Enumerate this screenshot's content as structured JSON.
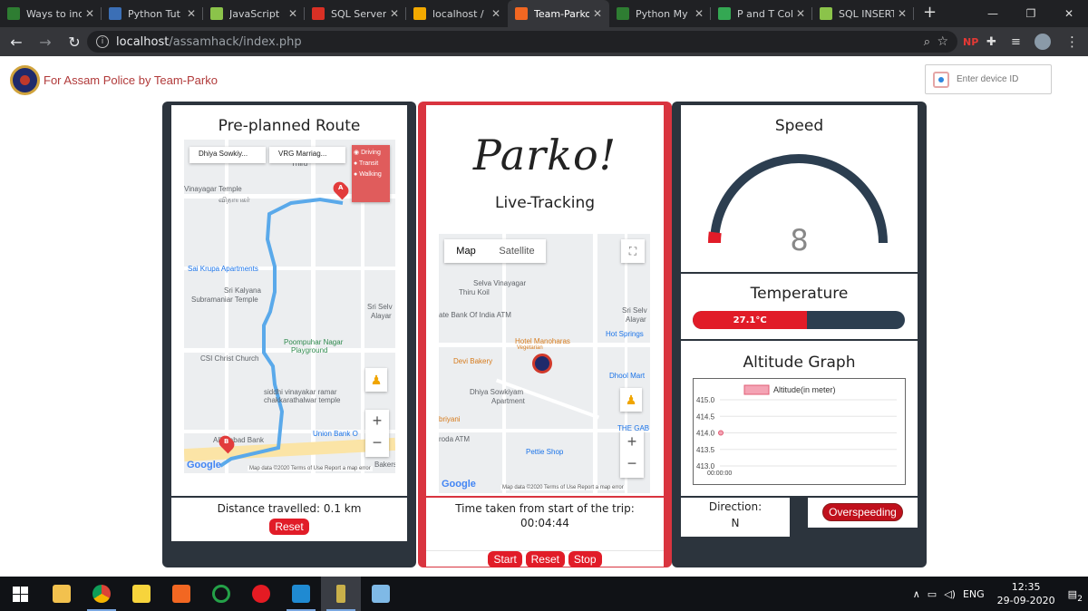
{
  "browser": {
    "tabs": [
      {
        "title": "Ways to inc",
        "color": "#2e7d32"
      },
      {
        "title": "Python Tut",
        "color": "#3b6fb6"
      },
      {
        "title": "JavaScript",
        "color": "#8bc34a"
      },
      {
        "title": "SQL Server",
        "color": "#d93025"
      },
      {
        "title": "localhost /",
        "color": "#f2a900"
      },
      {
        "title": "Team-Parko",
        "color": "#f26722"
      },
      {
        "title": "Python My",
        "color": "#2e7d32"
      },
      {
        "title": "P and T Col",
        "color": "#34a853"
      },
      {
        "title": "SQL INSERT",
        "color": "#8bc34a"
      }
    ],
    "active_tab": 5,
    "url_host": "localhost",
    "url_path": "/assamhack/index.php",
    "new_tab": "+",
    "ext_np": "NP"
  },
  "header": {
    "brand": "For Assam Police by Team-Parko",
    "device_placeholder": "Enter device ID"
  },
  "route": {
    "title": "Pre-planned Route",
    "from": "Dhiya Sowkiy...",
    "to": "VRG Marriag...",
    "modes": [
      "Driving",
      "Transit",
      "Walking"
    ],
    "places": [
      "Vinayagar Temple",
      "விநாயகர்",
      "Sai Krupa Apartments",
      "Sri Kalyana",
      "Subramaniar Temple",
      "Sri Selv",
      "Alayar",
      "Poompuhar Nagar",
      "Playground",
      "CSI Christ Church",
      "siddhi vinayakar ramar",
      "chakkarathalwar temple",
      "Union Bank O",
      "Allahabad Bank",
      "Bakers",
      "Thiru"
    ],
    "marker_a": "A",
    "marker_b": "B",
    "zoom_in": "+",
    "zoom_out": "−",
    "attribution": [
      "Map data ©2020",
      "Terms of Use",
      "Report a map error"
    ],
    "google": "Google",
    "distance": "Distance travelled: 0.1 km",
    "reset": "Reset"
  },
  "live": {
    "logo": "Parko!",
    "title": "Live-Tracking",
    "map_type": "Map",
    "satellite": "Satellite",
    "places": [
      "Selva Vinayagar",
      "Thiru Koil",
      "ate Bank Of India ATM",
      "Hotel Manoharas",
      "Vegetarian",
      "Hot Springs",
      "Devi Bakery",
      "Dhool Mart",
      "Dhiya Sowkiyam",
      "Apartment",
      "briyani",
      "THE GAB",
      "roda ATM",
      "Pettie Shop",
      "Sri Selv",
      "Alayar"
    ],
    "zoom_in": "+",
    "zoom_out": "−",
    "attribution": [
      "Map data ©2020",
      "Terms of Use",
      "Report a map error"
    ],
    "google": "Google",
    "time_label": "Time taken from start of the trip:",
    "time_value": "00:04:44",
    "buttons": [
      "Start",
      "Reset",
      "Stop"
    ]
  },
  "speed": {
    "title": "Speed",
    "value": "8",
    "fraction": 0.04
  },
  "temperature": {
    "title": "Temperature",
    "value": "27.1°C",
    "fraction": 0.54,
    "color": "#e11c28"
  },
  "altitude": {
    "title": "Altitude Graph",
    "chart_data": {
      "type": "line",
      "series": [
        {
          "name": "Altitude(in meter)",
          "values": [
            414.0
          ]
        }
      ],
      "x": [
        "00:00:00"
      ],
      "yticks": [
        "415.0",
        "414.5",
        "414.0",
        "413.5",
        "413.0"
      ],
      "ylim": [
        413.0,
        415.0
      ],
      "color": "#f4a3b4"
    }
  },
  "direction": {
    "label": "Direction:",
    "value": "N"
  },
  "overspeed": {
    "label": "Overspeeding"
  },
  "taskbar": {
    "lang": "ENG",
    "time": "12:35",
    "date": "29-09-2020",
    "notif": "2"
  }
}
